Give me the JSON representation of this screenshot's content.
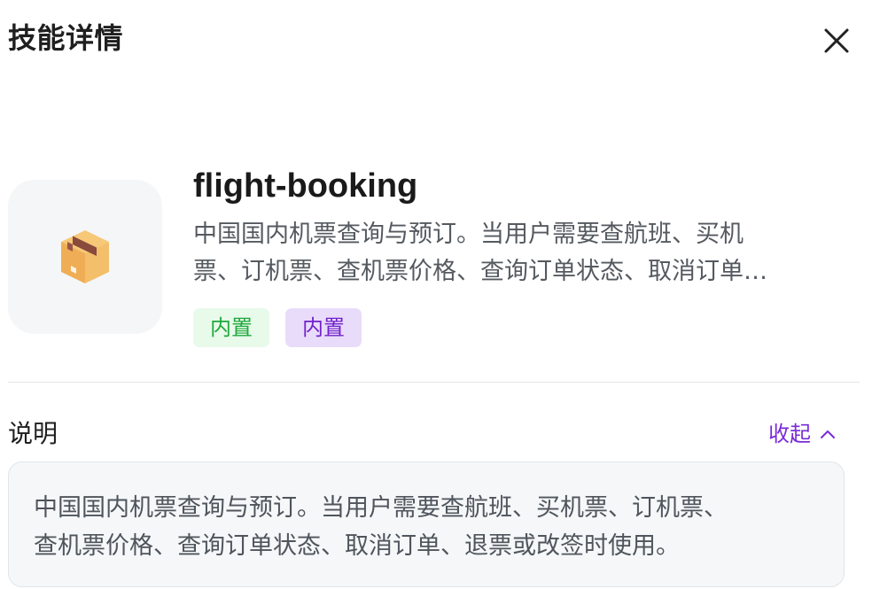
{
  "header": {
    "title": "技能详情"
  },
  "skill": {
    "name": "flight-booking",
    "icon": "package-box-icon",
    "summary_lines": [
      "中国国内机票查询与预订。当用户需要查航班、买机",
      "票、订机票、查机票价格、查询订单状态、取消订单…"
    ],
    "tags": [
      {
        "label": "内置",
        "color": "#20a83c",
        "background": "#e8faea"
      },
      {
        "label": "内置",
        "color": "#7122c9",
        "background": "#e9dcfb"
      }
    ]
  },
  "description_section": {
    "title": "说明",
    "toggle_label": "收起",
    "toggle_icon": "chevron-up-icon",
    "text_lines": [
      "中国国内机票查询与预订。当用户需要查航班、买机票、订机票、",
      "查机票价格、查询订单状态、取消订单、退票或改签时使用。"
    ]
  },
  "colors": {
    "accent": "#7a2bd8",
    "divider": "#e4e4e7",
    "icon_box_bg": "#f5f6f8"
  }
}
